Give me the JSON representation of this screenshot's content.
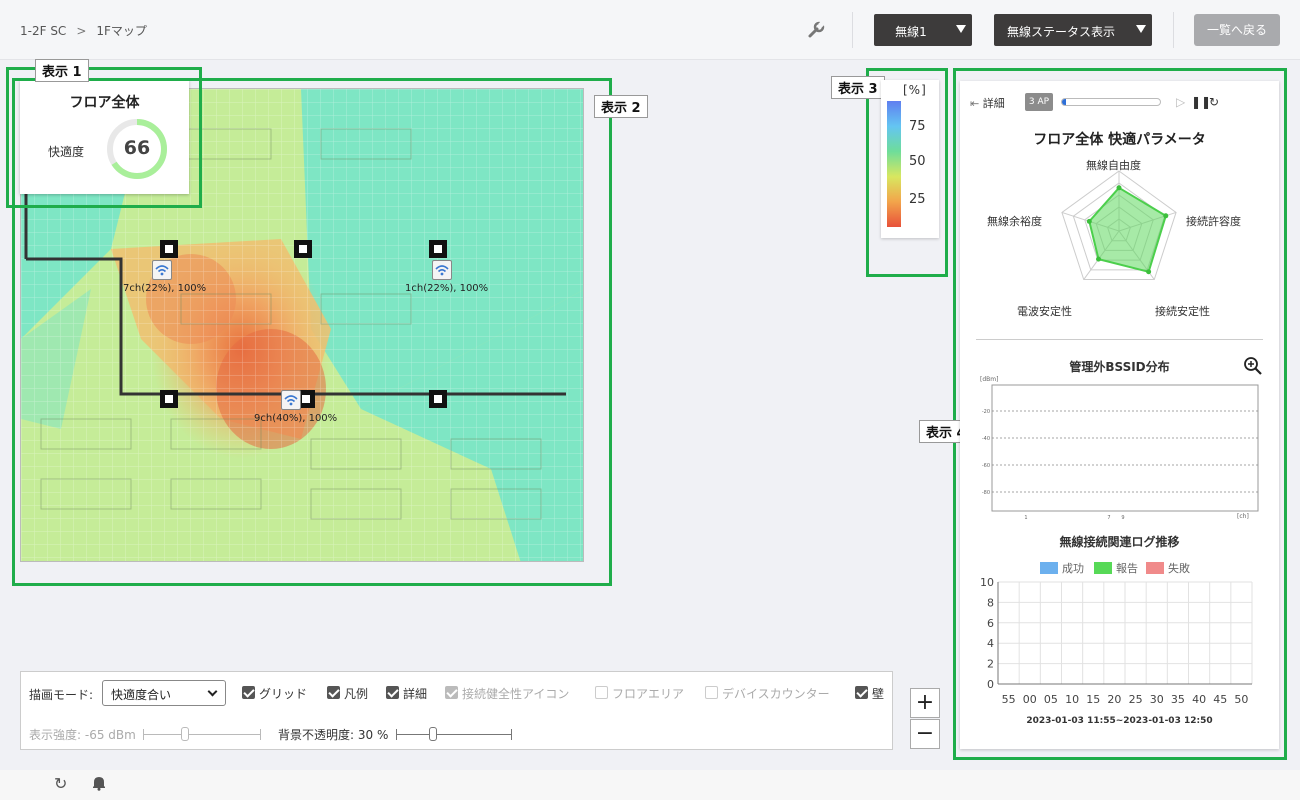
{
  "breadcrumb": {
    "root": "1-2F SC",
    "separator": ">",
    "current": "1Fマップ"
  },
  "toolbar": {
    "wireless_label": "無線1",
    "status_label": "無線ステータス表示",
    "back_label": "一覧へ戻る",
    "icons": [
      "wrench-icon"
    ]
  },
  "display_labels": {
    "d1": "表示 1",
    "d2": "表示 2",
    "d3": "表示 3",
    "d4": "表示 4"
  },
  "floor_card": {
    "title": "フロア全体",
    "comfort_label": "快適度",
    "score": "66",
    "score_value": 66
  },
  "aps": [
    {
      "caption": "7ch(22%), 100%"
    },
    {
      "caption": "1ch(22%), 100%"
    },
    {
      "caption": "9ch(40%), 100%"
    }
  ],
  "legend": {
    "unit": "[%]",
    "ticks": [
      "75",
      "50",
      "25"
    ]
  },
  "right_panel": {
    "detail_label": "詳細",
    "ap_count": "3 AP",
    "progress": 0.04,
    "radar_title": "フロア全体 快適パラメータ",
    "radar_axes": [
      "無線自由度",
      "接続許容度",
      "接続安定性",
      "電波安定性",
      "無線余裕度"
    ],
    "radar_values": [
      0.72,
      0.82,
      0.84,
      0.58,
      0.52
    ],
    "bssid_title": "管理外BSSID分布",
    "bssid_unit_y": "[dBm]",
    "bssid_unit_x": "[ch]",
    "bssid_y_ticks": [
      "-20",
      "-40",
      "-60",
      "-80"
    ],
    "bssid_x_ticks": [
      "1",
      "7",
      "9"
    ],
    "log_title": "無線接続関連ログ推移",
    "log_legend": [
      {
        "label": "成功",
        "color": "#6cb0ee"
      },
      {
        "label": "報告",
        "color": "#57d957"
      },
      {
        "label": "失敗",
        "color": "#f08a8a"
      }
    ],
    "log_y_ticks": [
      "10",
      "8",
      "6",
      "4",
      "2",
      "0"
    ],
    "log_x_ticks": [
      "55",
      "00",
      "05",
      "10",
      "15",
      "20",
      "25",
      "30",
      "35",
      "40",
      "45",
      "50"
    ],
    "date_range": "2023-01-03 11:55~2023-01-03 12:50"
  },
  "controls": {
    "mode_label": "描画モード:",
    "mode_value": "快適度合い",
    "checkboxes": [
      {
        "label": "グリッド",
        "checked": true,
        "disabled": false
      },
      {
        "label": "凡例",
        "checked": true,
        "disabled": false
      },
      {
        "label": "詳細",
        "checked": true,
        "disabled": false
      },
      {
        "label": "接続健全性アイコン",
        "checked": true,
        "disabled": true
      },
      {
        "label": "フロアエリア",
        "checked": false,
        "disabled": true
      },
      {
        "label": "デバイスカウンター",
        "checked": false,
        "disabled": true
      },
      {
        "label": "壁",
        "checked": true,
        "disabled": false
      }
    ],
    "strength_label": "表示強度: -65 dBm",
    "opacity_label": "背景不透明度: 30 %"
  },
  "zoom": {
    "in": "+",
    "out": "−"
  }
}
